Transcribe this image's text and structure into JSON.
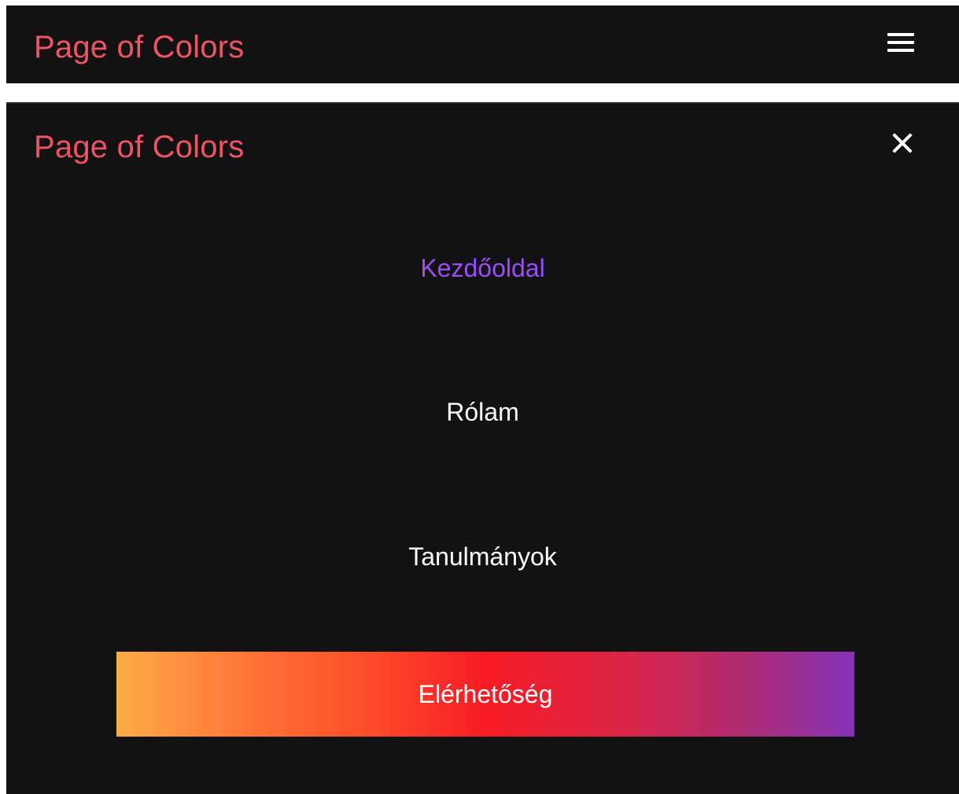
{
  "header": {
    "brand": "Page of Colors",
    "menu_icon": "hamburger-menu-icon"
  },
  "menu": {
    "brand": "Page of Colors",
    "close_icon": "close-icon",
    "items": [
      {
        "label": "Kezdőoldal",
        "active": true
      },
      {
        "label": "Rólam",
        "active": false
      },
      {
        "label": "Tanulmányok",
        "active": false
      }
    ],
    "cta_label": "Elérhetőség"
  },
  "colors": {
    "background": "#121212",
    "brand": "#ef5466",
    "active_link": "#9b4dff",
    "link": "#ffffff",
    "cta_gradient": [
      "#fbac47",
      "#f71b24",
      "#8533b8"
    ]
  }
}
